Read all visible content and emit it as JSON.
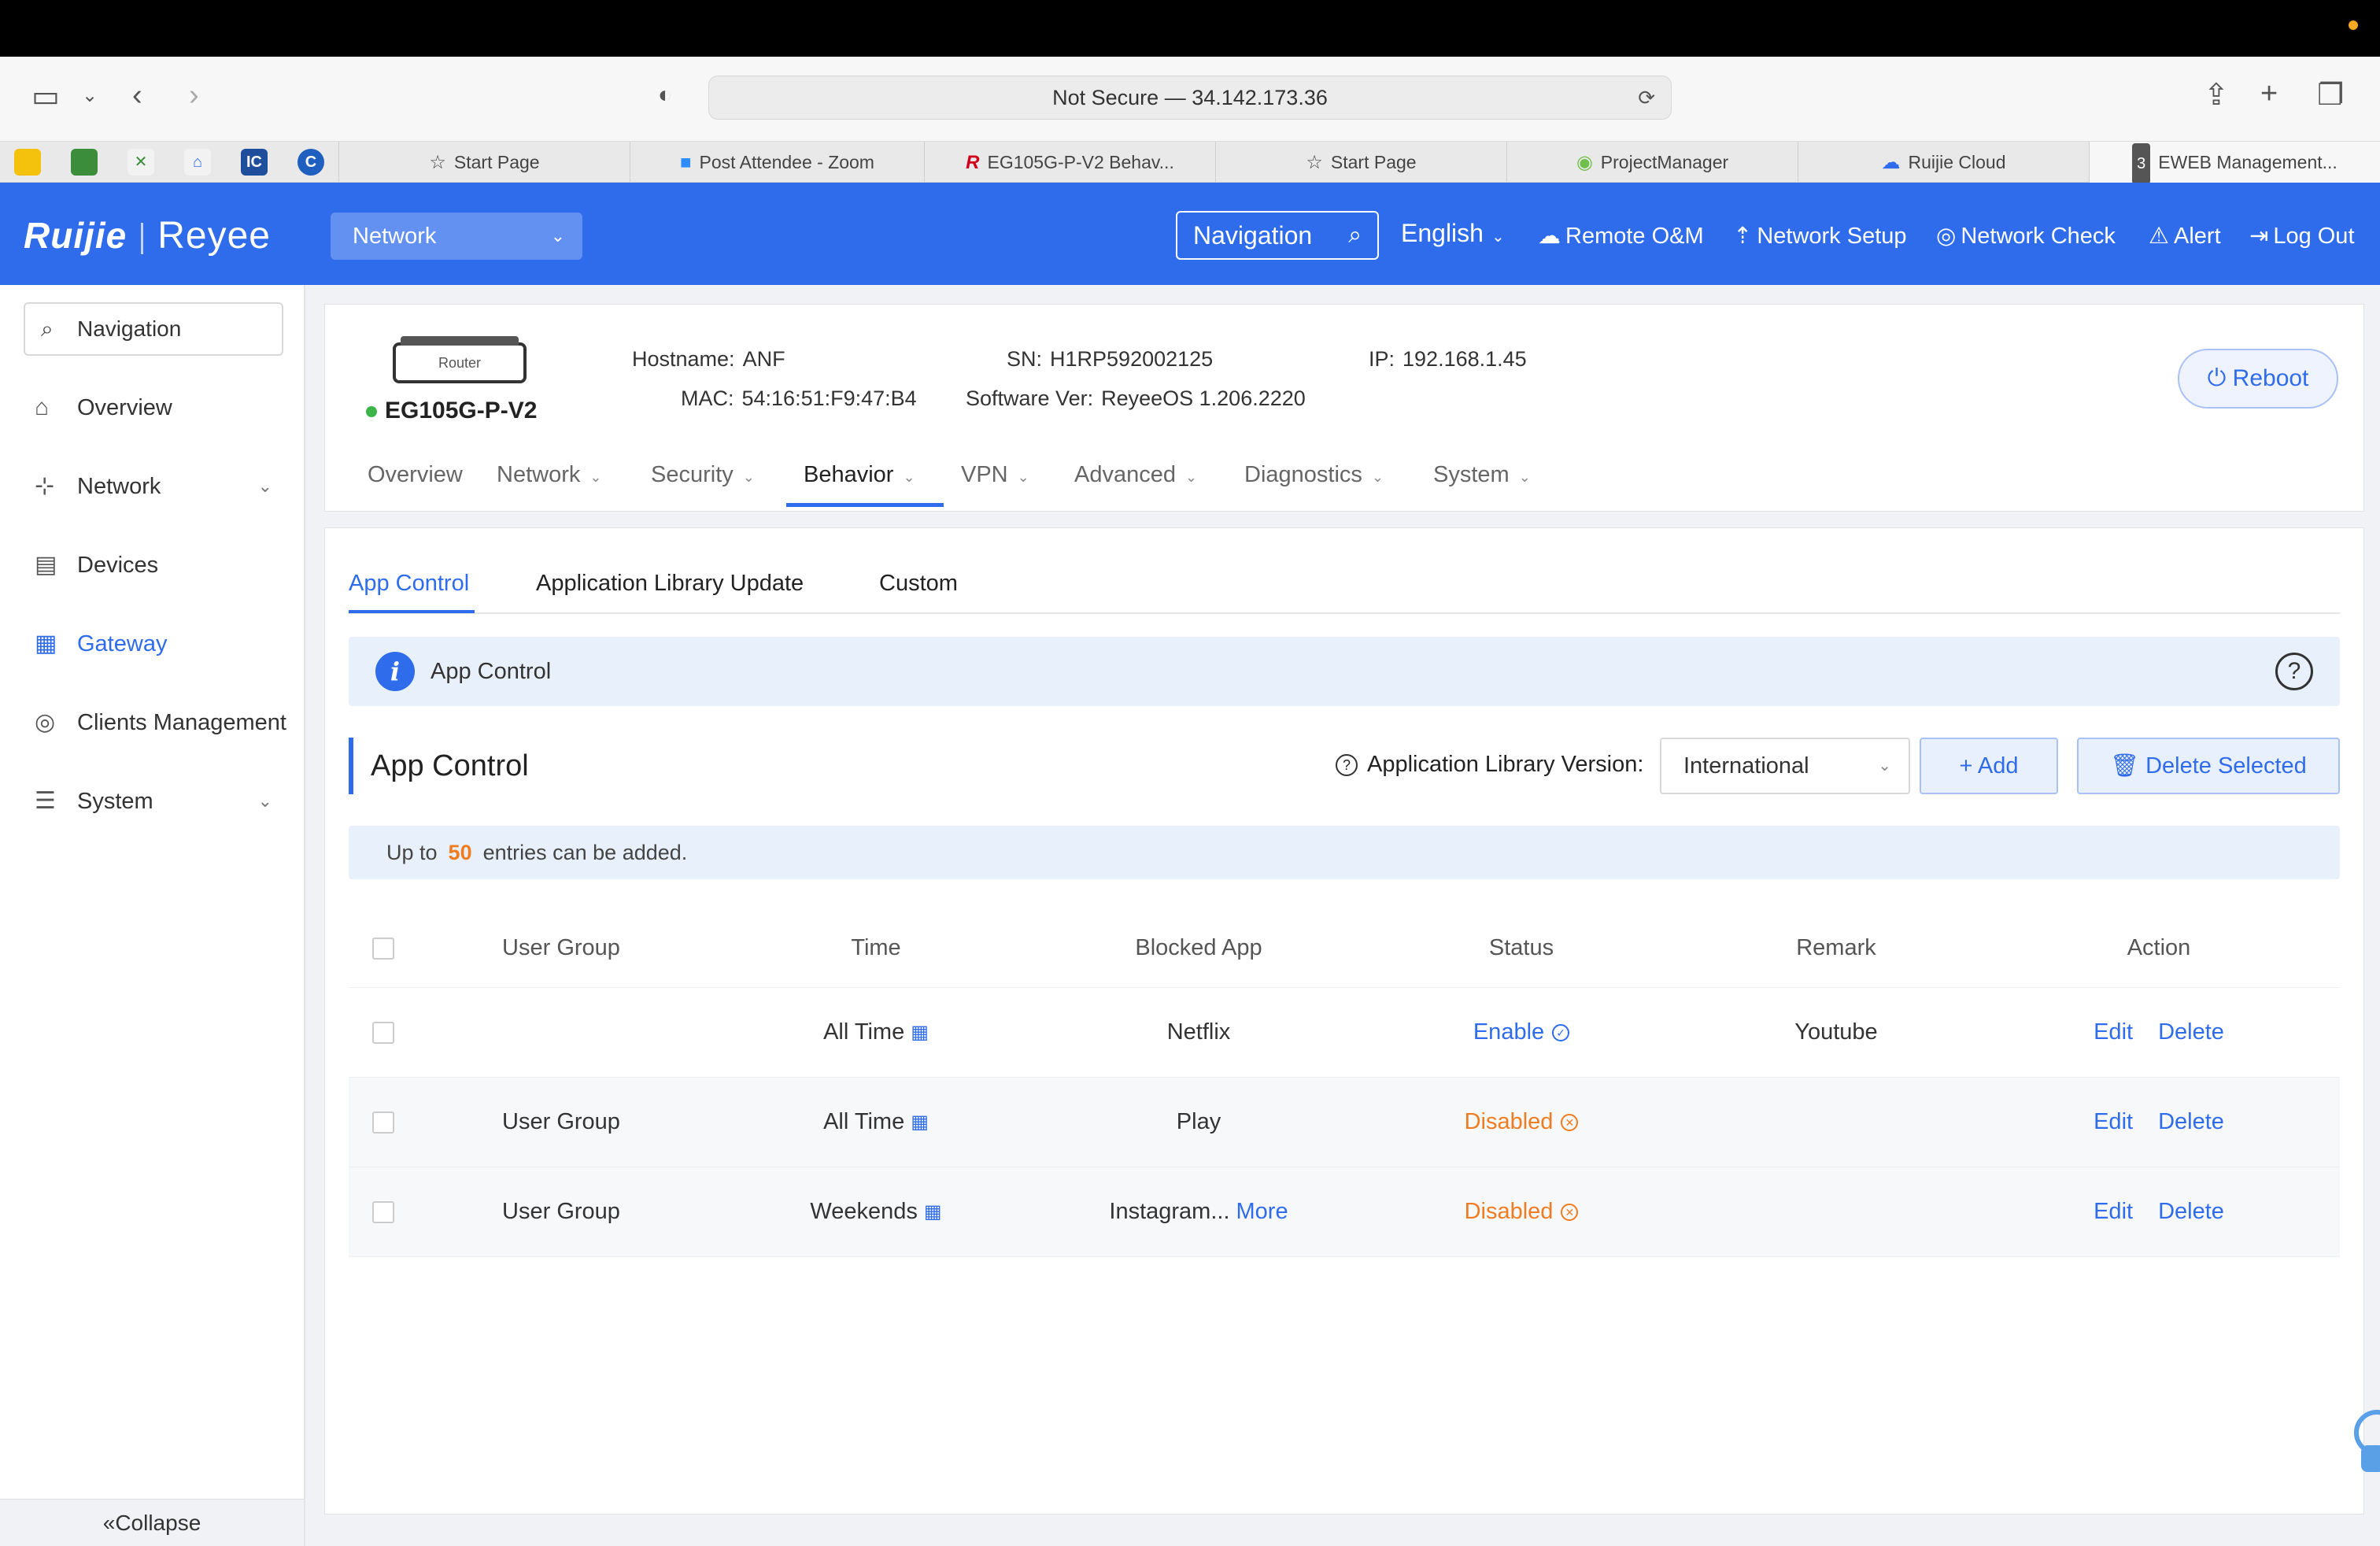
{
  "browser": {
    "url_text": "Not Secure — 34.142.173.36",
    "tabs": [
      {
        "icon": "star-icon",
        "label": "Start Page"
      },
      {
        "icon": "zoom-icon",
        "label": "Post Attendee - Zoom"
      },
      {
        "icon": "ruijie-icon",
        "label": "EG105G-P-V2 Behav..."
      },
      {
        "icon": "star-icon",
        "label": "Start Page"
      },
      {
        "icon": "pm-icon",
        "label": "ProjectManager"
      },
      {
        "icon": "cloud-icon",
        "label": "Ruijie Cloud"
      },
      {
        "icon": "eweb-icon",
        "label": "EWEB Management..."
      }
    ],
    "favicons": [
      "IC"
    ]
  },
  "header": {
    "logo_main": "Ruijie",
    "logo_sub": "Reyee",
    "network_select": "Network",
    "navigation_label": "Navigation",
    "language": "English",
    "links": [
      "Remote O&M",
      "Network Setup",
      "Network Check",
      "Alert",
      "Log Out"
    ],
    "accent_color": "#2f6cec"
  },
  "sidebar": {
    "search_placeholder": "Navigation",
    "items": [
      {
        "label": "Overview",
        "icon": "home-icon"
      },
      {
        "label": "Network",
        "icon": "network-icon"
      },
      {
        "label": "Devices",
        "icon": "devices-icon"
      },
      {
        "label": "Gateway",
        "icon": "gateway-icon",
        "active": true
      },
      {
        "label": "Clients Management",
        "icon": "clients-icon"
      },
      {
        "label": "System",
        "icon": "system-icon"
      }
    ],
    "collapse_label": "Collapse"
  },
  "device": {
    "image_label": "Router",
    "model": "EG105G-P-V2",
    "hostname_label": "Hostname:",
    "hostname": "ANF",
    "mac_label": "MAC:",
    "mac": "54:16:51:F9:47:B4",
    "sn_label": "SN:",
    "sn": "H1RP592002125",
    "software_label": "Software Ver:",
    "software": "ReyeeOS 1.206.2220",
    "ip_label": "IP:",
    "ip": "192.168.1.45",
    "reboot_label": "Reboot",
    "tabs": [
      "Overview",
      "Network",
      "Security",
      "Behavior",
      "VPN",
      "Advanced",
      "Diagnostics",
      "System"
    ],
    "active_tab": "Behavior"
  },
  "main": {
    "subtabs": [
      "App Control",
      "Application Library Update",
      "Custom"
    ],
    "info_text": "App Control",
    "section_title": "App Control",
    "library_version_label": "Application Library Version:",
    "library_version_value": "International",
    "add_label": "Add",
    "delete_selected_label": "Delete Selected",
    "limit_prefix": "Up to",
    "limit_number": "50",
    "limit_suffix": "entries can be added.",
    "table": {
      "headers": [
        "User Group",
        "Time",
        "Blocked App",
        "Status",
        "Remark",
        "Action"
      ],
      "rows": [
        {
          "user_group": "",
          "time": "All Time",
          "blocked_app": "Netflix",
          "more": "",
          "status": "Enable",
          "remark": "Youtube",
          "edit": "Edit",
          "delete": "Delete"
        },
        {
          "user_group": "User Group",
          "time": "All Time",
          "blocked_app": "Play",
          "more": "",
          "status": "Disabled",
          "remark": "",
          "edit": "Edit",
          "delete": "Delete"
        },
        {
          "user_group": "User Group",
          "time": "Weekends",
          "blocked_app": "Instagram...",
          "more": "More",
          "status": "Disabled",
          "remark": "",
          "edit": "Edit",
          "delete": "Delete"
        }
      ]
    }
  }
}
